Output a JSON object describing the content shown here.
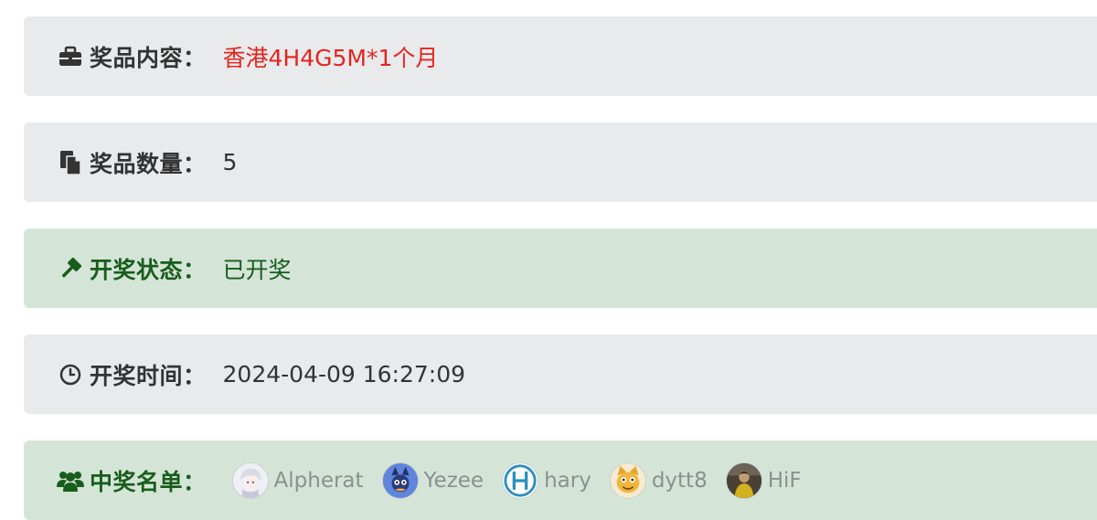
{
  "prize": {
    "content_label": "奖品内容：",
    "content_value": "香港4H4G5M*1个月",
    "quantity_label": "奖品数量：",
    "quantity_value": "5"
  },
  "draw": {
    "status_label": "开奖状态：",
    "status_value": "已开奖",
    "time_label": "开奖时间：",
    "time_value": "2024-04-09 16:27:09"
  },
  "winners": {
    "label": "中奖名单：",
    "list": [
      {
        "name": "Alpherat",
        "avatar": "anime-girl-avatar"
      },
      {
        "name": "Yezee",
        "avatar": "blue-cartoon-avatar"
      },
      {
        "name": "hary",
        "avatar": "h-letter-avatar"
      },
      {
        "name": "dytt8",
        "avatar": "cat-avatar"
      },
      {
        "name": "HiF",
        "avatar": "person-photo-avatar"
      }
    ]
  },
  "colors": {
    "panel_gray": "#e9eaec",
    "panel_green": "#d4e5d7",
    "label_green": "#185d1c",
    "prize_red": "#e3251f",
    "winner_name": "#8a9090"
  },
  "icons": [
    "briefcase-icon",
    "copy-icon",
    "gavel-icon",
    "clock-icon",
    "users-icon"
  ]
}
